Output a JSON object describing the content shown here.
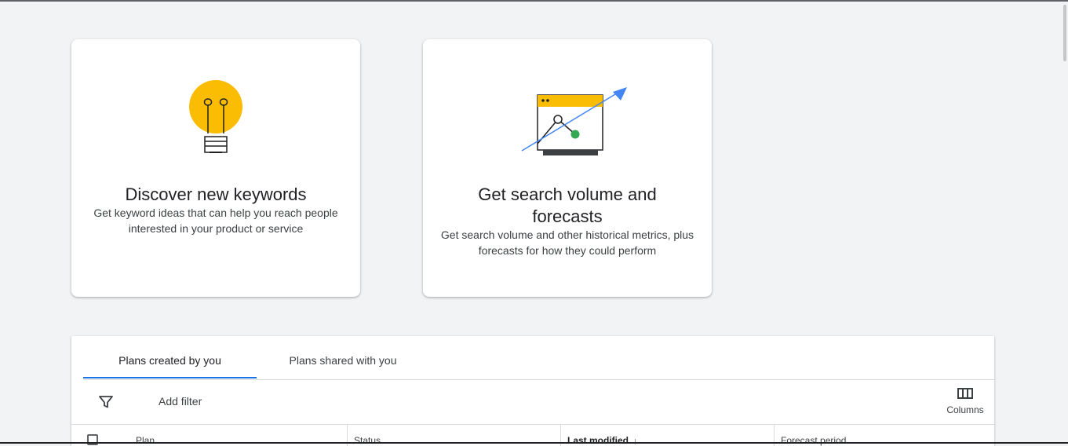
{
  "cards": [
    {
      "title": "Discover new keywords",
      "description": "Get keyword ideas that can help you reach people interested in your product or service",
      "icon": "lightbulb-icon"
    },
    {
      "title": "Get search volume and forecasts",
      "description": "Get search volume and other historical metrics, plus forecasts for how they could perform",
      "icon": "forecast-chart-icon"
    }
  ],
  "tabs": [
    {
      "label": "Plans created by you",
      "active": true
    },
    {
      "label": "Plans shared with you",
      "active": false
    }
  ],
  "toolbar": {
    "filter_icon": "filter-icon",
    "add_filter_label": "Add filter",
    "columns_label": "Columns",
    "columns_icon": "columns-icon"
  },
  "table": {
    "columns": [
      "Plan",
      "Status",
      "Last modified",
      "Forecast period"
    ],
    "sorted_column": "Last modified",
    "sort_direction": "descending"
  },
  "colors": {
    "accent": "#1a73e8",
    "bulb": "#fbbc04",
    "green": "#34a853",
    "background": "#f1f3f4"
  }
}
